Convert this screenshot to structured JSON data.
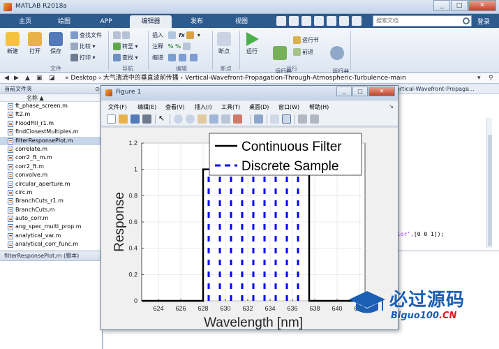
{
  "window": {
    "title": "MATLAB R2018a"
  },
  "tabs": [
    {
      "label": "主页"
    },
    {
      "label": "绘图"
    },
    {
      "label": "APP"
    },
    {
      "label": "编辑器"
    },
    {
      "label": "发布"
    },
    {
      "label": "视图"
    }
  ],
  "search": {
    "placeholder": "搜索文档"
  },
  "login_label": "登录",
  "ribbon": {
    "new_label": "新建",
    "open_label": "打开",
    "save_label": "保存",
    "find_files_label": "查找文件",
    "compare_label": "比较",
    "print_label": "打印",
    "goto_label": "转至",
    "find_label": "查找",
    "insert_label": "插入",
    "comment_label": "注释",
    "indent_label": "缩进",
    "breakpoint_label": "断点",
    "run_label": "运行",
    "run_advance_label": "运行并\n前进",
    "run_section_label": "运行节",
    "advance_label": "前进",
    "run_time_label": "运行并\n计时",
    "groups": {
      "file": "文件",
      "navigate": "导航",
      "edit": "编辑",
      "breakpoints": "断点",
      "run": "运行"
    }
  },
  "address": {
    "path": "« Desktop › 大气湍流中的垂直波前传播 › Vertical-Wavefront-Propagation-Through-Atmospheric-Turbulence-main"
  },
  "folder_panel": {
    "title": "当前文件夹",
    "column_name": "名称 ▲",
    "files": [
      "ft_phase_screen.m",
      "ft2.m",
      "FloodFill_r1.m",
      "findClosestMultiples.m",
      "filterResponsePlot.m",
      "correlate.m",
      "corr2_ft_m.m",
      "corr2_ft.m",
      "convolve.m",
      "circular_aperture.m",
      "circ.m",
      "BranchCuts_r1.m",
      "BranchCuts.m",
      "auto_corr.m",
      "ang_spec_multi_prop.m",
      "analytical_var.m",
      "analytical_corr_func.m"
    ],
    "selected_index": 4
  },
  "details_panel": {
    "title": "filterResponsePlot.m  (脚本)"
  },
  "editor": {
    "tab_label": "Vertical-Wavefront-Propaga...",
    "code_prefix": "olor',",
    "code_suffix": "[0 0 1]);"
  },
  "figure": {
    "title": "Figure 1",
    "menu": [
      "文件(F)",
      "编辑(E)",
      "查看(V)",
      "插入(I)",
      "工具(T)",
      "桌面(D)",
      "窗口(W)",
      "帮助(H)"
    ]
  },
  "chart_data": {
    "type": "line",
    "xlabel": "Wavelength [nm]",
    "ylabel": "Response",
    "xlim": [
      622.5,
      642.5
    ],
    "ylim": [
      0,
      1.2
    ],
    "xticks": [
      624,
      626,
      628,
      630,
      632,
      634,
      636,
      638,
      640,
      642
    ],
    "yticks": [
      0,
      0.2,
      0.4,
      0.6,
      0.8,
      1,
      1.2
    ],
    "grid": true,
    "legend_position": "top-right",
    "series": [
      {
        "name": "Continuous Filter",
        "style": "solid",
        "color": "#000000",
        "x": [
          622.5,
          628.0,
          628.0,
          637.5,
          637.5,
          642.5
        ],
        "y": [
          0,
          0,
          1,
          1,
          0,
          0
        ]
      },
      {
        "name": "Discrete Sample",
        "style": "dashed-stem",
        "color": "#0000ff",
        "x": [
          628.5,
          629.5,
          630.5,
          631.5,
          632.5,
          633.5,
          634.5,
          635.5,
          636.5
        ],
        "y": [
          1,
          1,
          1,
          1,
          1,
          1,
          1,
          1,
          1
        ]
      }
    ]
  },
  "watermark": {
    "cn": "必过源码",
    "en_prefix": "Biguo100",
    "en_suffix": ".CN"
  }
}
